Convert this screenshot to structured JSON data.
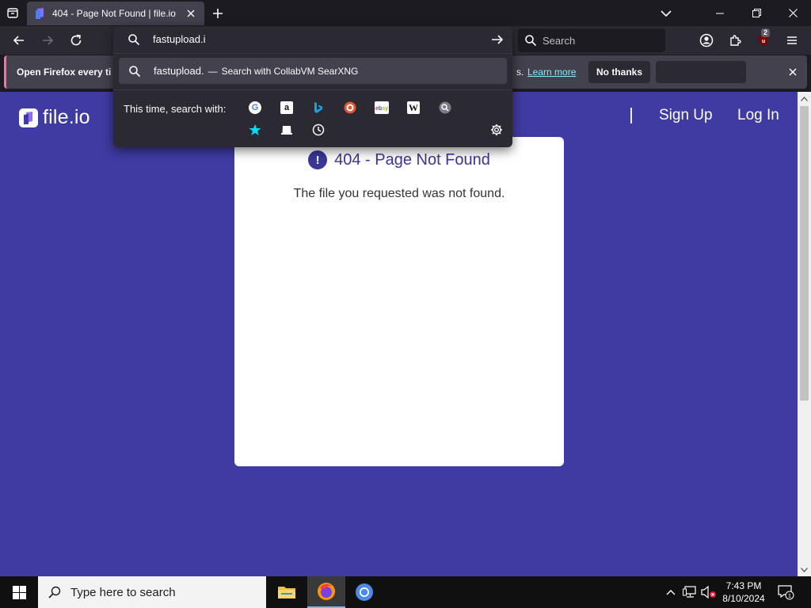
{
  "browser": {
    "tab": {
      "title": "404 - Page Not Found | file.io"
    },
    "searchbar": {
      "placeholder": "Search"
    },
    "extension_badge": "2"
  },
  "urlbar": {
    "value": "fastupload.i",
    "suggestion": {
      "query": "fastupload.",
      "dash": "—",
      "action": "Search with CollabVM SearXNG"
    },
    "oneoff_label": "This time, search with:",
    "engines": [
      "google-icon",
      "amazon-icon",
      "bing-icon",
      "duckduckgo-icon",
      "ebay-icon",
      "wikipedia-icon",
      "searxng-icon",
      "bookmarks-icon",
      "tabs-icon",
      "history-icon"
    ]
  },
  "notification": {
    "text": "Open Firefox every ti",
    "tail": "s.",
    "link": "Learn more",
    "button": "No thanks"
  },
  "page": {
    "logo": "file.io",
    "nav": {
      "signup": "Sign Up",
      "login": "Log In"
    },
    "card": {
      "icon": "!",
      "title": "404 - Page Not Found",
      "message": "The file you requested was not found."
    }
  },
  "taskbar": {
    "search_placeholder": "Type here to search",
    "time": "7:43 PM",
    "date": "8/10/2024",
    "notification_count": "1"
  },
  "colors": {
    "page_bg": "#3f3ba2",
    "accent": "#3a3797",
    "link": "#80ebff",
    "notif_border": "#ff6f9d"
  }
}
